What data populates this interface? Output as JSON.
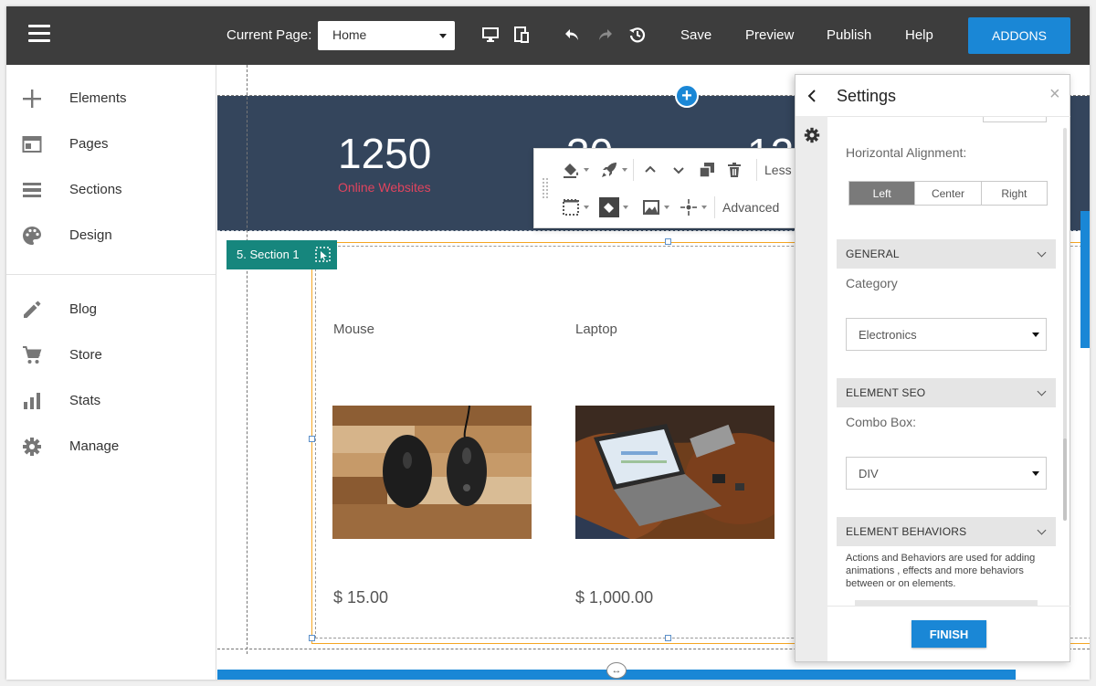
{
  "topbar": {
    "menu_icon": "hamburger-icon",
    "current_page_label": "Current Page:",
    "page_select_value": "Home",
    "icons": [
      "desktop-icon",
      "tablet-icon",
      "undo-icon",
      "redo-icon",
      "history-icon"
    ],
    "save_label": "Save",
    "preview_label": "Preview",
    "publish_label": "Publish",
    "help_label": "Help",
    "addons_label": "ADDONS"
  },
  "sidebar": {
    "items": [
      {
        "label": "Elements",
        "icon": "plus-icon"
      },
      {
        "label": "Pages",
        "icon": "pages-icon"
      },
      {
        "label": "Sections",
        "icon": "sections-icon"
      },
      {
        "label": "Design",
        "icon": "palette-icon"
      },
      {
        "label": "Blog",
        "icon": "pencil-icon"
      },
      {
        "label": "Store",
        "icon": "cart-icon"
      },
      {
        "label": "Stats",
        "icon": "bar-chart-icon"
      },
      {
        "label": "Manage",
        "icon": "gear-icon"
      }
    ]
  },
  "canvas": {
    "stats": [
      {
        "number": "1250",
        "label": "Online Websites"
      },
      {
        "number": "30"
      },
      {
        "number": "12"
      }
    ],
    "toolbar": {
      "less_label": "Less",
      "advanced_label": "Advanced"
    },
    "section_tag": "5. Section 1",
    "products": [
      {
        "name": "Mouse",
        "price": "$ 15.00",
        "image": "mouse-photo"
      },
      {
        "name": "Laptop",
        "price": "$ 1,000.00",
        "image": "laptop-photo"
      }
    ]
  },
  "settings": {
    "title": "Settings",
    "horizontal_alignment_label": "Horizontal Alignment:",
    "alignment_options": [
      "Left",
      "Center",
      "Right"
    ],
    "alignment_selected": "Left",
    "general_header": "GENERAL",
    "category_label": "Category",
    "category_value": "Electronics",
    "seo_header": "ELEMENT SEO",
    "combo_label": "Combo Box:",
    "combo_value": "DIV",
    "behaviors_header": "ELEMENT BEHAVIORS",
    "behaviors_desc": "Actions and Behaviors are used for adding animations , effects and more behaviors between or on elements.",
    "finish_label": "FINISH"
  },
  "colors": {
    "topbar": "#3d3d3d",
    "accent": "#1a87d6",
    "hero": "#34455c",
    "stat_label": "#e0445e",
    "section_tag": "#16867d"
  }
}
